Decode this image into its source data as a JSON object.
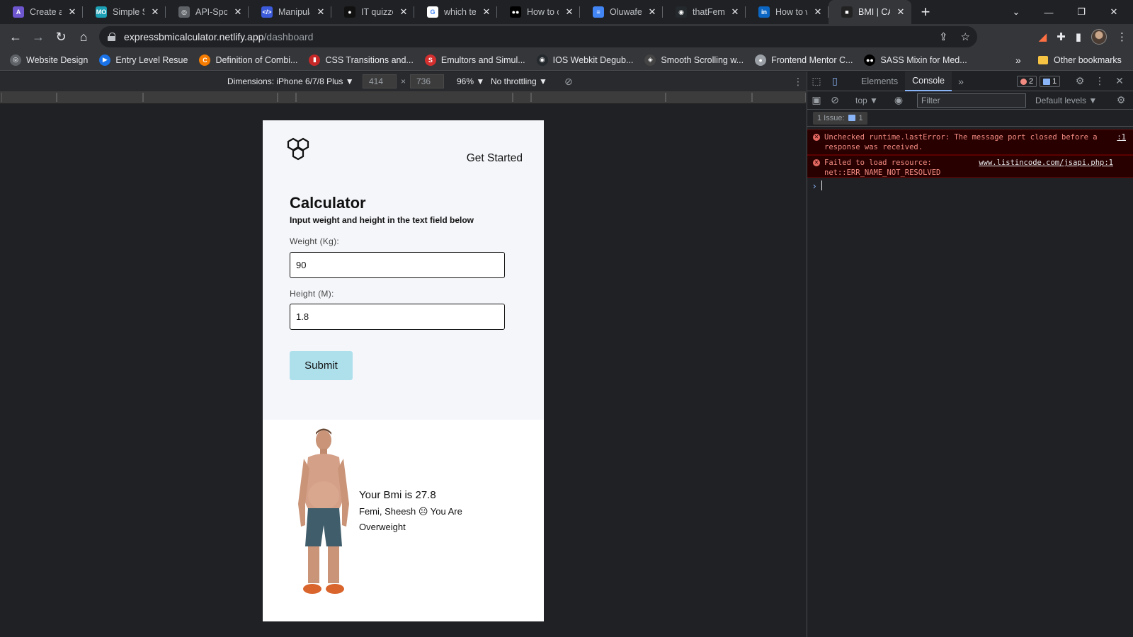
{
  "tabs": [
    {
      "title": "Create an",
      "favicon": "A",
      "color": "#6e56cf"
    },
    {
      "title": "Simple Sol",
      "favicon": "MO",
      "color": "#1ba0b5"
    },
    {
      "title": "API-Sports",
      "favicon": "◎",
      "color": "#5f6368"
    },
    {
      "title": "Manipulat",
      "favicon": "</>",
      "color": "#3b5bdb"
    },
    {
      "title": "IT quizzes",
      "favicon": "●",
      "color": "#111111"
    },
    {
      "title": "which tech",
      "favicon": "G",
      "color": "#ffffff"
    },
    {
      "title": "How to cre",
      "favicon": "●●",
      "color": "#000000"
    },
    {
      "title": "Oluwafem",
      "favicon": "≡",
      "color": "#4285f4"
    },
    {
      "title": "thatFemic",
      "favicon": "◉",
      "color": "#24292e"
    },
    {
      "title": "How to wr",
      "favicon": "in",
      "color": "#0a66c2"
    },
    {
      "title": "BMI | CALC",
      "favicon": "■",
      "color": "#222222"
    }
  ],
  "address": {
    "host": "expressbmicalculator.netlify.app",
    "path": "/dashboard"
  },
  "bookmarks": [
    {
      "label": "Website Design",
      "color": "#5f6368",
      "icon": "◎"
    },
    {
      "label": "Entry Level Resue",
      "color": "#1a73e8",
      "icon": "▶"
    },
    {
      "label": "Definition of Combi...",
      "color": "#f57c00",
      "icon": "C"
    },
    {
      "label": "CSS Transitions and...",
      "color": "#c62828",
      "icon": "▮"
    },
    {
      "label": "Emultors and Simul...",
      "color": "#d32f2f",
      "icon": "S"
    },
    {
      "label": "IOS Webkit Degub...",
      "color": "#24292e",
      "icon": "◉"
    },
    {
      "label": "Smooth Scrolling w...",
      "color": "#444444",
      "icon": "◈"
    },
    {
      "label": "Frontend Mentor C...",
      "color": "#9aa0a6",
      "icon": "●"
    },
    {
      "label": "SASS Mixin for Med...",
      "color": "#000000",
      "icon": "●●"
    }
  ],
  "bookmarks_other": "Other bookmarks",
  "bookmarks_more": "»",
  "device_toolbar": {
    "dimensions": "Dimensions: iPhone 6/7/8 Plus ▼",
    "width": "414",
    "height": "736",
    "times": "×",
    "zoom": "96% ▼",
    "throttle": "No throttling ▼"
  },
  "page": {
    "nav_link": "Get Started",
    "title": "Calculator",
    "subtitle": "Input weight and height in the text field below",
    "weight_label": "Weight (Kg):",
    "weight_value": "90",
    "height_label": "Height (M):",
    "height_value": "1.8",
    "submit_label": "Submit",
    "result_line1": "Your Bmi is 27.8",
    "result_line2": "Femi, Sheesh ☹ You Are Overweight"
  },
  "devtools": {
    "tabs": [
      "Elements",
      "Console"
    ],
    "active_tab": "Console",
    "more": "»",
    "error_count": "2",
    "message_count": "1",
    "context": "top ▼",
    "filter_placeholder": "Filter",
    "levels": "Default levels ▼",
    "issues": "1 Issue:",
    "issues_count": "1",
    "errors": [
      {
        "text": "Unchecked runtime.lastError: The message port closed before a response was received.",
        "link": ":1"
      },
      {
        "text": "Failed to load resource: net::ERR_NAME_NOT_RESOLVED",
        "link": "www.listincode.com/jsapi.php:1"
      }
    ],
    "prompt": "›"
  },
  "colors": {
    "accent": "#8ab4f8",
    "submit_bg": "#aee0ec",
    "error_text": "#f28b82"
  }
}
